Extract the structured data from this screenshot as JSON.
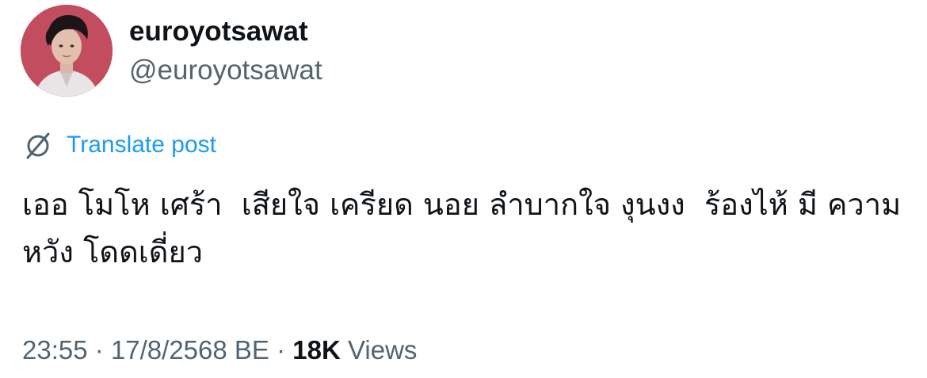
{
  "author": {
    "display_name": "euroyotsawat",
    "handle": "@euroyotsawat",
    "avatar_icon": "profile-avatar-photo"
  },
  "translate": {
    "icon": "translate-globe-icon",
    "label": "Translate post",
    "color": "#1d9bf0"
  },
  "post": {
    "text": "เออ โมโห เศร้า  เสียใจ เครียด นอย ลำบากใจ งุนงง  ร้องไห้ มี ความหวัง โดดเดี่ยว"
  },
  "meta": {
    "time": "23:55",
    "separator": "·",
    "date": "17/8/2568 BE",
    "views_count": "18K",
    "views_label": "Views"
  },
  "colors": {
    "text_primary": "#0f1419",
    "text_secondary": "#536471",
    "accent": "#1d9bf0",
    "avatar_background": "#c24d5e"
  }
}
